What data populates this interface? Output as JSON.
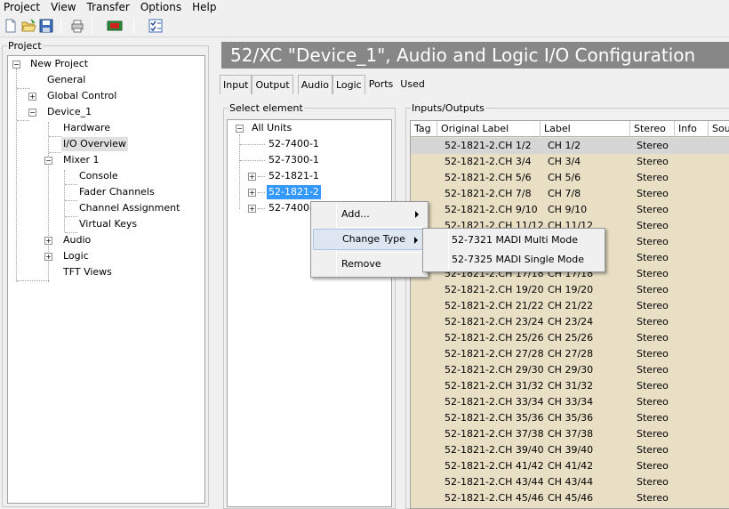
{
  "menubar": [
    "Project",
    "View",
    "Transfer",
    "Options",
    "Help"
  ],
  "toolbar": {
    "icons": [
      "new-file-icon",
      "open-folder-icon",
      "save-icon",
      "print-icon",
      "device-red-icon",
      "checklist-icon"
    ]
  },
  "project_panel": {
    "title": "Project",
    "tree": [
      {
        "label": "New Project",
        "expanded": true
      },
      {
        "label": "General"
      },
      {
        "label": "Global Control",
        "expandable": true
      },
      {
        "label": "Device_1",
        "expanded": true
      },
      {
        "label": "Hardware"
      },
      {
        "label": "I/O Overview",
        "selected": true
      },
      {
        "label": "Mixer 1",
        "expanded": true
      },
      {
        "label": "Console"
      },
      {
        "label": "Fader Channels"
      },
      {
        "label": "Channel Assignment"
      },
      {
        "label": "Virtual Keys"
      },
      {
        "label": "Audio",
        "expandable": true
      },
      {
        "label": "Logic",
        "expandable": true
      },
      {
        "label": "TFT Views"
      }
    ]
  },
  "banner": {
    "title": "52/XC \"Device_1\", Audio and Logic I/O  Configuration"
  },
  "tabs": [
    "Input",
    "Output",
    "Audio",
    "Logic",
    "Ports",
    "Used"
  ],
  "select_panel": {
    "title": "Select element",
    "root": "All Units",
    "units": [
      "52-7400-1",
      "52-7300-1",
      "52-1821-1",
      "52-1821-2",
      "52-7400-1"
    ]
  },
  "io_panel": {
    "title": "Inputs/Outputs",
    "columns": [
      "Tag",
      "Original Label",
      "Label",
      "Stereo",
      "Info",
      "Sou"
    ],
    "rows": [
      {
        "orig": "52-1821-2.CH 1/2",
        "label": "CH 1/2",
        "stereo": "Stereo"
      },
      {
        "orig": "52-1821-2.CH 3/4",
        "label": "CH 3/4",
        "stereo": "Stereo"
      },
      {
        "orig": "52-1821-2.CH 5/6",
        "label": "CH 5/6",
        "stereo": "Stereo"
      },
      {
        "orig": "52-1821-2.CH 7/8",
        "label": "CH 7/8",
        "stereo": "Stereo"
      },
      {
        "orig": "52-1821-2.CH 9/10",
        "label": "CH 9/10",
        "stereo": "Stereo"
      },
      {
        "orig": "52-1821-2.CH 11/12",
        "label": "CH 11/12",
        "stereo": "Stereo"
      },
      {
        "orig": "",
        "label": "",
        "stereo": "Stereo"
      },
      {
        "orig": "",
        "label": "",
        "stereo": "Stereo"
      },
      {
        "orig": "52-1821-2.CH 17/18",
        "label": "CH 17/18",
        "stereo": "Stereo"
      },
      {
        "orig": "52-1821-2.CH 19/20",
        "label": "CH 19/20",
        "stereo": "Stereo"
      },
      {
        "orig": "52-1821-2.CH 21/22",
        "label": "CH 21/22",
        "stereo": "Stereo"
      },
      {
        "orig": "52-1821-2.CH 23/24",
        "label": "CH 23/24",
        "stereo": "Stereo"
      },
      {
        "orig": "52-1821-2.CH 25/26",
        "label": "CH 25/26",
        "stereo": "Stereo"
      },
      {
        "orig": "52-1821-2.CH 27/28",
        "label": "CH 27/28",
        "stereo": "Stereo"
      },
      {
        "orig": "52-1821-2.CH 29/30",
        "label": "CH 29/30",
        "stereo": "Stereo"
      },
      {
        "orig": "52-1821-2.CH 31/32",
        "label": "CH 31/32",
        "stereo": "Stereo"
      },
      {
        "orig": "52-1821-2.CH 33/34",
        "label": "CH 33/34",
        "stereo": "Stereo"
      },
      {
        "orig": "52-1821-2.CH 35/36",
        "label": "CH 35/36",
        "stereo": "Stereo"
      },
      {
        "orig": "52-1821-2.CH 37/38",
        "label": "CH 37/38",
        "stereo": "Stereo"
      },
      {
        "orig": "52-1821-2.CH 39/40",
        "label": "CH 39/40",
        "stereo": "Stereo"
      },
      {
        "orig": "52-1821-2.CH 41/42",
        "label": "CH 41/42",
        "stereo": "Stereo"
      },
      {
        "orig": "52-1821-2.CH 43/44",
        "label": "CH 43/44",
        "stereo": "Stereo"
      },
      {
        "orig": "52-1821-2.CH 45/46",
        "label": "CH 45/46",
        "stereo": "Stereo"
      }
    ]
  },
  "context_menu": {
    "items": [
      "Add...",
      "Change Type",
      "Remove"
    ]
  },
  "submenu": {
    "items": [
      "52-7321 MADI Multi Mode",
      "52-7325 MADI Single Mode"
    ]
  },
  "colors": {
    "banner_bg": "#878787",
    "grid_bg": "#e8dfc4",
    "selection": "#3399ff"
  }
}
